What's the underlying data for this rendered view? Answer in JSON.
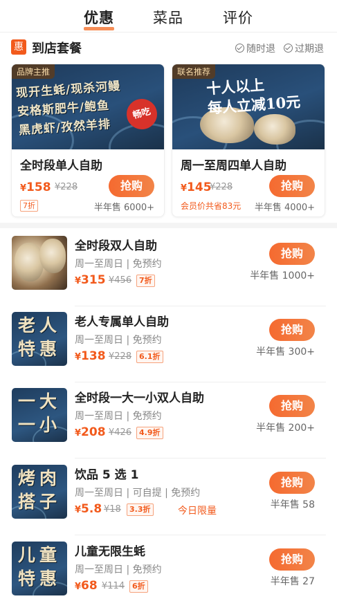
{
  "tabs": [
    {
      "label": "优惠",
      "active": true
    },
    {
      "label": "菜品",
      "active": false
    },
    {
      "label": "评价",
      "active": false
    }
  ],
  "section": {
    "badge": "惠",
    "title": "到店套餐",
    "policies": [
      "随时退",
      "过期退"
    ]
  },
  "featured": [
    {
      "tag": "品牌主推",
      "art_lines": [
        "现开生蚝/现杀河鳗",
        "安格斯肥牛/鲍鱼",
        "黑虎虾/孜然羊排"
      ],
      "stamp": "畅吃",
      "name": "全时段单人自助",
      "currency": "¥",
      "price": "158",
      "original": "¥228",
      "discount": "7折",
      "member_note": "",
      "sold": "半年售 6000+",
      "button": "抢购"
    },
    {
      "tag": "联名推荐",
      "art_lines": [
        "十人以上",
        "每人立减10元"
      ],
      "stamp": "",
      "name": "周一至周四单人自助",
      "currency": "¥",
      "price": "145",
      "original": "¥228",
      "discount": "",
      "member_note": "会员价共省83元",
      "sold": "半年售 4000+",
      "button": "抢购"
    }
  ],
  "deals": [
    {
      "name": "全时段双人自助",
      "sub": "周一至周日 | 免预约",
      "thumb_text": "",
      "currency": "¥",
      "price": "315",
      "original": "¥456",
      "discount": "7折",
      "limit": "",
      "sold": "半年售 1000+",
      "button": "抢购"
    },
    {
      "name": "老人专属单人自助",
      "sub": "周一至周日 | 免预约",
      "thumb_text": "老人特惠",
      "currency": "¥",
      "price": "138",
      "original": "¥228",
      "discount": "6.1折",
      "limit": "",
      "sold": "半年售 300+",
      "button": "抢购"
    },
    {
      "name": "全时段一大一小双人自助",
      "sub": "周一至周日 | 免预约",
      "thumb_text": "一大一小",
      "currency": "¥",
      "price": "208",
      "original": "¥426",
      "discount": "4.9折",
      "limit": "",
      "sold": "半年售 200+",
      "button": "抢购"
    },
    {
      "name": "饮品 5 选 1",
      "sub": "周一至周日 | 可自提 | 免预约",
      "thumb_text": "烤肉搭子",
      "currency": "¥",
      "price": "5.8",
      "original": "¥18",
      "discount": "3.3折",
      "limit": "今日限量",
      "sold": "半年售 58",
      "button": "抢购"
    },
    {
      "name": "儿童无限生蚝",
      "sub": "周一至周日 | 免预约",
      "thumb_text": "儿童特惠",
      "currency": "¥",
      "price": "68",
      "original": "¥114",
      "discount": "6折",
      "limit": "",
      "sold": "半年售 27",
      "button": "抢购"
    }
  ],
  "colors": {
    "accent": "#f25a1c",
    "button": "#f56a30",
    "poster_bg": "#1e3a5a"
  }
}
